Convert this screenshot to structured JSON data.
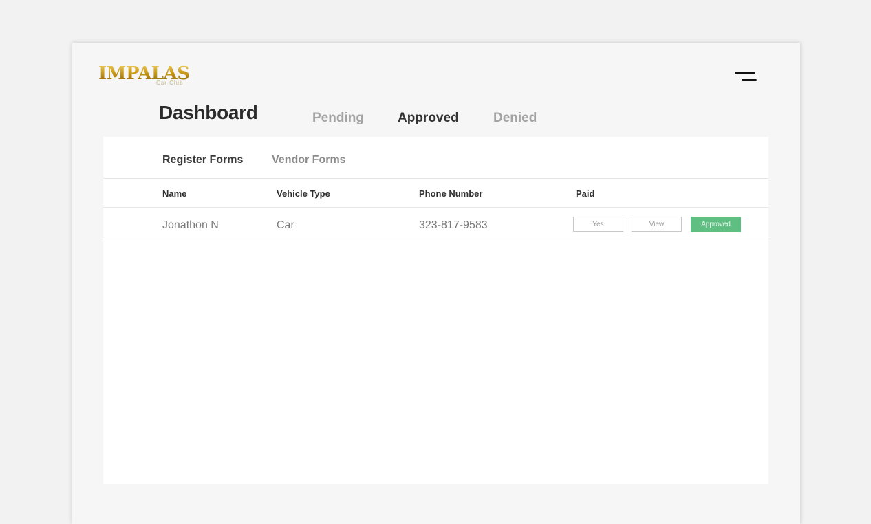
{
  "brand": {
    "logo_text": "IMPALAS",
    "logo_subtext": "Car Club"
  },
  "header": {
    "title": "Dashboard",
    "status_tabs": [
      {
        "label": "Pending",
        "active": false
      },
      {
        "label": "Approved",
        "active": true
      },
      {
        "label": "Denied",
        "active": false
      }
    ]
  },
  "forms": {
    "tabs": [
      {
        "label": "Register Forms",
        "active": true
      },
      {
        "label": "Vendor Forms",
        "active": false
      }
    ]
  },
  "table": {
    "columns": [
      "Name",
      "Vehicle Type",
      "Phone Number",
      "Paid"
    ],
    "rows": [
      {
        "name": "Jonathon N",
        "vehicle_type": "Car",
        "phone": "323-817-9583",
        "paid": "Yes",
        "view_label": "View",
        "status": "Approved"
      }
    ]
  },
  "icons": {
    "menu": "hamburger-menu-icon"
  },
  "colors": {
    "approved": "#5fbf82",
    "background": "#f2f2f2",
    "logo_gold": "#c99a1a"
  }
}
